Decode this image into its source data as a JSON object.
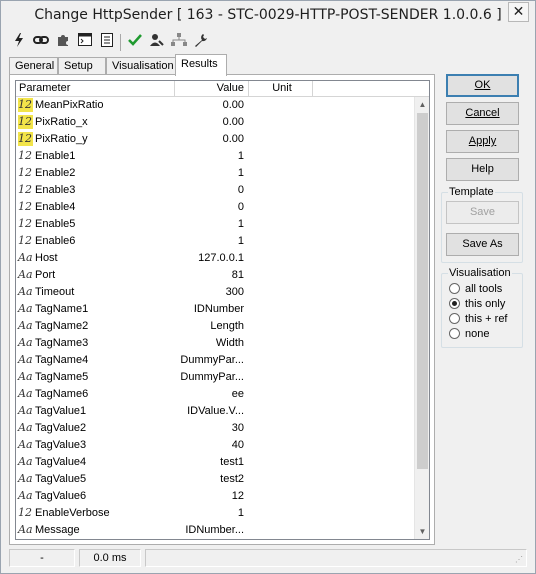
{
  "window": {
    "title": "Change HttpSender [ 163 - STC-0029-HTTP-POST-SENDER 1.0.0.6 ]",
    "close_glyph": "✕"
  },
  "toolbar": {
    "icons": [
      "lightning-icon",
      "chain-link-icon",
      "puzzle-icon",
      "console-icon",
      "notes-icon",
      "checkmark-icon",
      "user-key-icon",
      "network-icon",
      "wrench-icon"
    ]
  },
  "tabs": [
    {
      "label": "General",
      "active": false
    },
    {
      "label": "Setup",
      "active": false
    },
    {
      "label": "Visualisation",
      "active": false
    },
    {
      "label": "Results",
      "active": true
    }
  ],
  "table": {
    "headers": {
      "parameter": "Parameter",
      "value": "Value",
      "unit": "Unit"
    },
    "rows": [
      {
        "type": "12",
        "highlight": true,
        "name": "MeanPixRatio",
        "value": "0.00"
      },
      {
        "type": "12",
        "highlight": true,
        "name": "PixRatio_x",
        "value": "0.00"
      },
      {
        "type": "12",
        "highlight": true,
        "name": "PixRatio_y",
        "value": "0.00"
      },
      {
        "type": "12",
        "highlight": false,
        "name": "Enable1",
        "value": "1"
      },
      {
        "type": "12",
        "highlight": false,
        "name": "Enable2",
        "value": "1"
      },
      {
        "type": "12",
        "highlight": false,
        "name": "Enable3",
        "value": "0"
      },
      {
        "type": "12",
        "highlight": false,
        "name": "Enable4",
        "value": "0"
      },
      {
        "type": "12",
        "highlight": false,
        "name": "Enable5",
        "value": "1"
      },
      {
        "type": "12",
        "highlight": false,
        "name": "Enable6",
        "value": "1"
      },
      {
        "type": "Aa",
        "highlight": false,
        "name": "Host",
        "value": "127.0.0.1"
      },
      {
        "type": "Aa",
        "highlight": false,
        "name": "Port",
        "value": "81"
      },
      {
        "type": "Aa",
        "highlight": false,
        "name": "Timeout",
        "value": "300"
      },
      {
        "type": "Aa",
        "highlight": false,
        "name": "TagName1",
        "value": "IDNumber"
      },
      {
        "type": "Aa",
        "highlight": false,
        "name": "TagName2",
        "value": "Length"
      },
      {
        "type": "Aa",
        "highlight": false,
        "name": "TagName3",
        "value": "Width"
      },
      {
        "type": "Aa",
        "highlight": false,
        "name": "TagName4",
        "value": "DummyPar..."
      },
      {
        "type": "Aa",
        "highlight": false,
        "name": "TagName5",
        "value": "DummyPar..."
      },
      {
        "type": "Aa",
        "highlight": false,
        "name": "TagName6",
        "value": "ee"
      },
      {
        "type": "Aa",
        "highlight": false,
        "name": "TagValue1",
        "value": "IDValue.V..."
      },
      {
        "type": "Aa",
        "highlight": false,
        "name": "TagValue2",
        "value": "30"
      },
      {
        "type": "Aa",
        "highlight": false,
        "name": "TagValue3",
        "value": "40"
      },
      {
        "type": "Aa",
        "highlight": false,
        "name": "TagValue4",
        "value": "test1"
      },
      {
        "type": "Aa",
        "highlight": false,
        "name": "TagValue5",
        "value": "test2"
      },
      {
        "type": "Aa",
        "highlight": false,
        "name": "TagValue6",
        "value": "12"
      },
      {
        "type": "12",
        "highlight": false,
        "name": "EnableVerbose",
        "value": "1"
      },
      {
        "type": "Aa",
        "highlight": false,
        "name": "Message",
        "value": "IDNumber..."
      }
    ]
  },
  "buttons": {
    "ok": "OK",
    "cancel": "Cancel",
    "apply": "Apply",
    "help": "Help"
  },
  "template": {
    "title": "Template",
    "save": "Save",
    "save_as": "Save As"
  },
  "visualisation": {
    "title": "Visualisation",
    "options": [
      {
        "label": "all tools",
        "selected": false
      },
      {
        "label": "this only",
        "selected": true
      },
      {
        "label": "this + ref",
        "selected": false
      },
      {
        "label": "none",
        "selected": false
      }
    ]
  },
  "status": {
    "cell1": "-",
    "cell2": "0.0 ms"
  }
}
